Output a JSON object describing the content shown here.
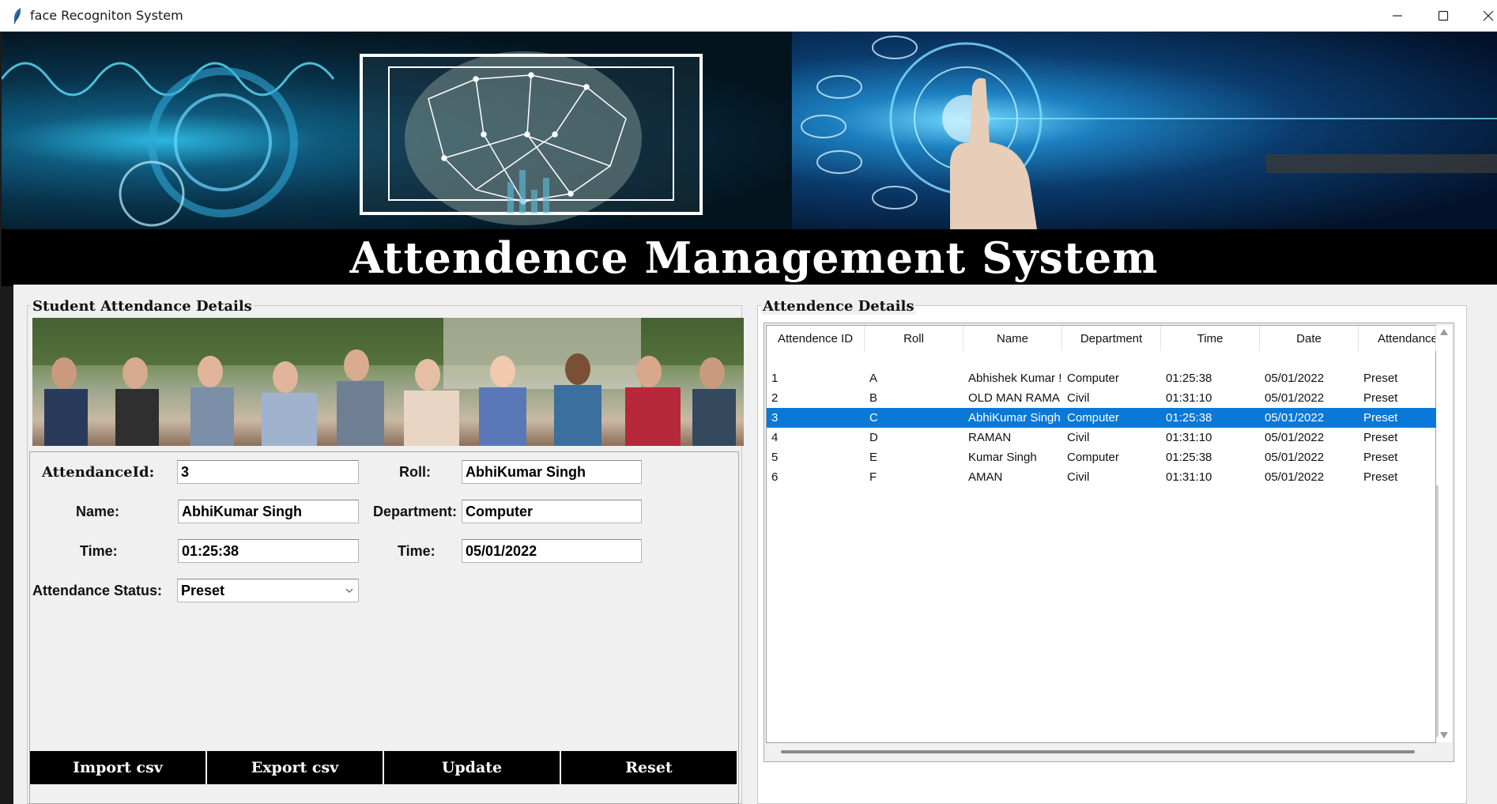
{
  "window": {
    "title": "face Recogniton System"
  },
  "header": {
    "title": "Attendence Management System"
  },
  "left_panel": {
    "title": "Student Attendance Details",
    "fields": {
      "attendance_id_label": "AttendanceId:",
      "attendance_id_value": "3",
      "roll_label": "Roll:",
      "roll_value": "AbhiKumar Singh",
      "name_label": "Name:",
      "name_value": "AbhiKumar Singh",
      "department_label": "Department:",
      "department_value": "Computer",
      "time_label": "Time:",
      "time_value": "01:25:38",
      "date_label": "Time:",
      "date_value": "05/01/2022",
      "status_label": "Attendance Status:",
      "status_value": "Preset"
    },
    "buttons": {
      "import": "Import csv",
      "export": "Export csv",
      "update": "Update",
      "reset": "Reset"
    }
  },
  "right_panel": {
    "title": "Attendence Details",
    "columns": [
      "Attendence ID",
      "Roll",
      "Name",
      "Department",
      "Time",
      "Date",
      "Attendance"
    ],
    "rows": [
      [
        "1",
        "A",
        "Abhishek Kumar !",
        "Computer",
        "01:25:38",
        "05/01/2022",
        "Preset"
      ],
      [
        "2",
        "B",
        "OLD MAN RAMA",
        "Civil",
        "01:31:10",
        "05/01/2022",
        "Preset"
      ],
      [
        "3",
        "C",
        "AbhiKumar Singh",
        "Computer",
        "01:25:38",
        "05/01/2022",
        "Preset"
      ],
      [
        "4",
        "D",
        " RAMAN",
        "Civil",
        "01:31:10",
        "05/01/2022",
        "Preset"
      ],
      [
        "5",
        "E",
        "Kumar Singh",
        "Computer",
        "01:25:38",
        "05/01/2022",
        "Preset"
      ],
      [
        "6",
        "F",
        "AMAN",
        "Civil",
        "01:31:10",
        "05/01/2022",
        "Preset"
      ]
    ],
    "selected_row": 2
  },
  "colors": {
    "selection": "#0a78d7",
    "header_bg": "#000000",
    "panel_bg": "#f0f0f0"
  },
  "icons": [
    "feather-icon",
    "minimize-icon",
    "maximize-icon",
    "close-icon",
    "chevron-down-icon",
    "scroll-up-icon",
    "scroll-down-icon"
  ]
}
